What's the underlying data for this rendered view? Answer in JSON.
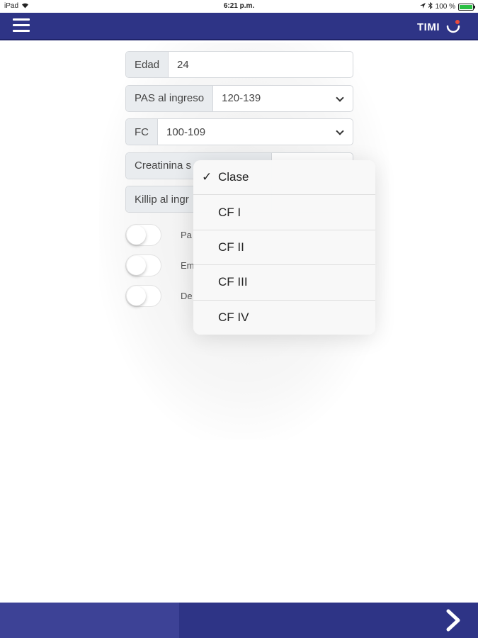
{
  "status_bar": {
    "device": "iPad",
    "time": "6:21 p.m.",
    "battery": "100 %"
  },
  "navbar": {
    "title": "TIMI",
    "menu_icon": "hamburger-menu-icon",
    "logo_icon": "smile-logo-icon",
    "accent": "#2e3486",
    "logo_dot": "#e94b3c"
  },
  "form": {
    "edad": {
      "label": "Edad",
      "value": "24"
    },
    "pas": {
      "label": "PAS al ingreso",
      "value": "120-139"
    },
    "fc": {
      "label": "FC",
      "value": "100-109"
    },
    "creatinina": {
      "label": "Creatinina s"
    },
    "killip": {
      "label": "Killip al ingr"
    }
  },
  "switches": [
    {
      "label": "Pa",
      "on": false
    },
    {
      "label": "Em",
      "on": false
    },
    {
      "label": "De",
      "on": false
    }
  ],
  "dropdown": {
    "selected": "Clase",
    "check": "✓",
    "options": [
      "Clase",
      "CF I",
      "CF II",
      "CF III",
      "CF IV"
    ]
  },
  "bottom_bar": {
    "next_icon": "chevron-right-icon"
  }
}
